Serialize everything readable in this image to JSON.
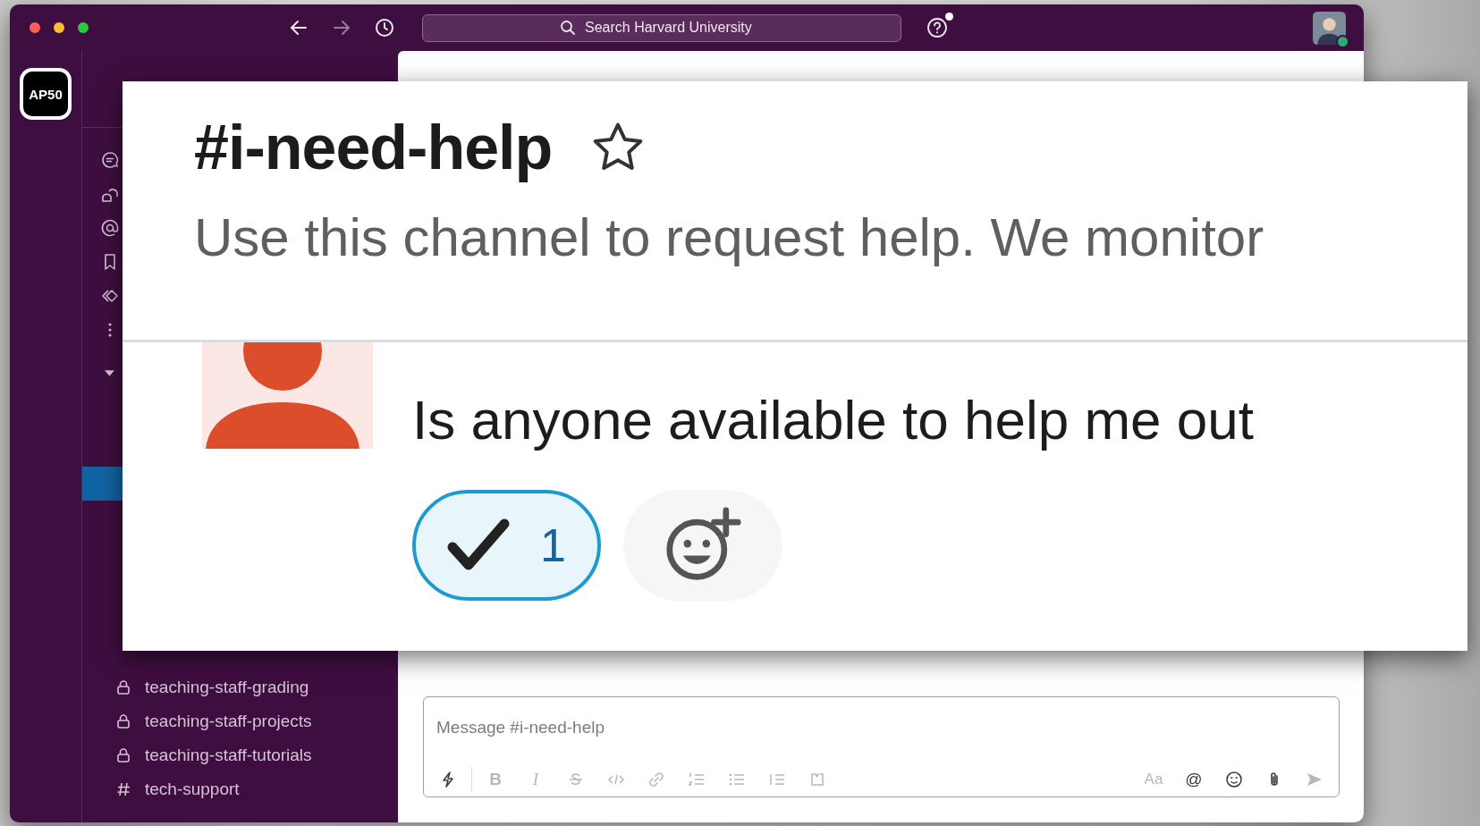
{
  "top_bar": {
    "nav": [
      {
        "kind": "back",
        "disabled": false
      },
      {
        "kind": "forward",
        "disabled": true
      },
      {
        "kind": "history",
        "disabled": false
      }
    ],
    "search": {
      "placeholder": "Search Harvard University"
    },
    "help": {
      "has_notification": true
    },
    "user": {
      "online": true
    }
  },
  "workspace": {
    "initials": "AP50"
  },
  "sidebar": {
    "channels": [
      {
        "name": "teaching-staff-grading",
        "kind": "private",
        "selected": false
      },
      {
        "name": "teaching-staff-projects",
        "kind": "private",
        "selected": false
      },
      {
        "name": "teaching-staff-tutorials",
        "kind": "private",
        "selected": false
      },
      {
        "name": "tech-support",
        "kind": "public",
        "selected": false
      }
    ]
  },
  "zoomed_view": {
    "channel": {
      "name": "#i-need-help",
      "starred": false,
      "description": "Use this channel to request help. We monitor"
    },
    "message": {
      "text": "Is anyone available to help me out",
      "reactions": [
        {
          "kind": "check",
          "count": "1",
          "selected": true
        }
      ]
    }
  },
  "composer": {
    "placeholder": "Message #i-need-help",
    "tools_left": [
      {
        "kind": "shortcuts",
        "disabled": false
      },
      {
        "kind": "bold",
        "label": "B",
        "disabled": true
      },
      {
        "kind": "italic",
        "label": "I",
        "disabled": true
      },
      {
        "kind": "strike",
        "disabled": true
      },
      {
        "kind": "code",
        "disabled": true
      },
      {
        "kind": "link",
        "disabled": true
      },
      {
        "kind": "ordered-list",
        "disabled": true
      },
      {
        "kind": "bullet-list",
        "disabled": true
      },
      {
        "kind": "quote",
        "disabled": true
      },
      {
        "kind": "code-block",
        "disabled": true
      }
    ],
    "tools_right": [
      {
        "kind": "format",
        "label": "Aa",
        "disabled": true
      },
      {
        "kind": "mention",
        "label": "@",
        "disabled": false
      },
      {
        "kind": "emoji",
        "disabled": false
      },
      {
        "kind": "attach",
        "disabled": false
      },
      {
        "kind": "send",
        "disabled": true
      }
    ]
  }
}
